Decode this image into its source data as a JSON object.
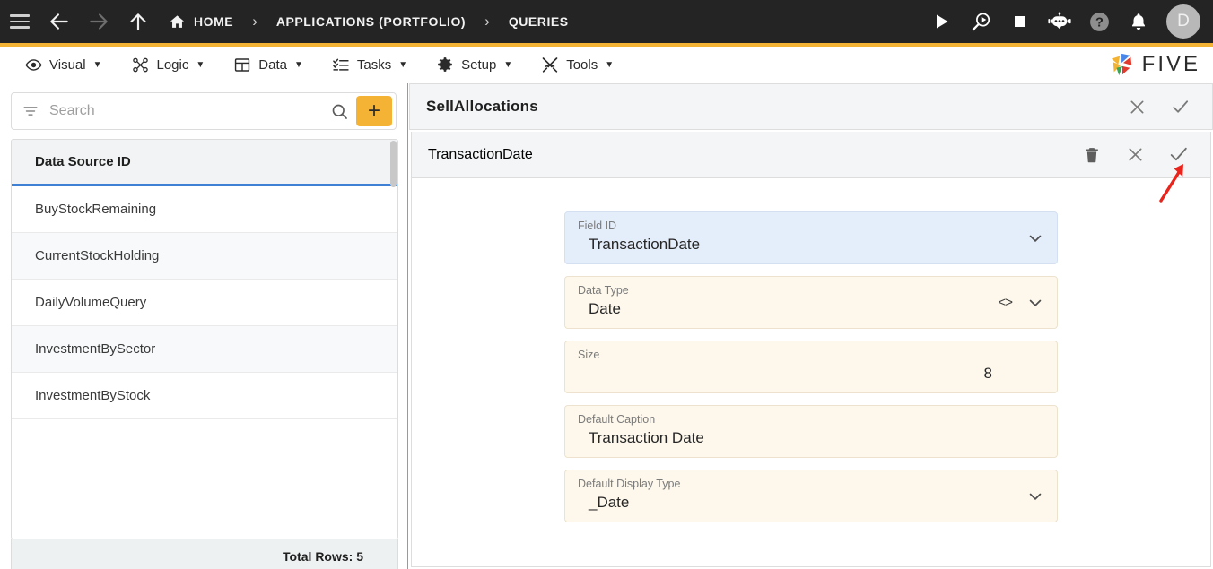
{
  "topnav": {
    "menu_icon": "hamburger-icon",
    "back_icon": "arrow-left-icon",
    "forward_icon": "arrow-right-icon",
    "up_icon": "arrow-up-icon",
    "home_icon": "home-icon",
    "breadcrumbs": [
      {
        "label": "HOME",
        "icon": "home-icon"
      },
      {
        "label": "APPLICATIONS (PORTFOLIO)",
        "icon": ""
      },
      {
        "label": "QUERIES",
        "icon": ""
      }
    ],
    "separator": "›",
    "tools": [
      {
        "name": "run-button",
        "icon": "play-icon"
      },
      {
        "name": "debug-button",
        "icon": "magnifier-play-icon"
      },
      {
        "name": "stop-button",
        "icon": "stop-square-icon"
      },
      {
        "name": "assistant-button",
        "icon": "robot-icon"
      },
      {
        "name": "help-button",
        "icon": "question-circle-icon"
      },
      {
        "name": "notifications-button",
        "icon": "bell-icon"
      }
    ],
    "avatar_initial": "D"
  },
  "menubar": {
    "items": [
      {
        "label": "Visual",
        "icon": "eye-icon",
        "caret": "▼"
      },
      {
        "label": "Logic",
        "icon": "flow-nodes-icon",
        "caret": "▼"
      },
      {
        "label": "Data",
        "icon": "table-grid-icon",
        "caret": "▼"
      },
      {
        "label": "Tasks",
        "icon": "checklist-icon",
        "caret": "▼"
      },
      {
        "label": "Setup",
        "icon": "gear-icon",
        "caret": "▼"
      },
      {
        "label": "Tools",
        "icon": "tools-cross-icon",
        "caret": "▼"
      }
    ],
    "brand": {
      "text": "FIVE",
      "mark": "five-pinwheel-logo"
    }
  },
  "left_panel": {
    "search": {
      "placeholder": "Search",
      "value": "",
      "filter_icon": "filter-icon",
      "search_icon": "search-icon"
    },
    "add_button": {
      "label": "+",
      "icon": "plus-icon"
    },
    "table": {
      "column_header": "Data Source ID",
      "rows": [
        {
          "name": "BuyStockRemaining"
        },
        {
          "name": "CurrentStockHolding"
        },
        {
          "name": "DailyVolumeQuery"
        },
        {
          "name": "InvestmentBySector"
        },
        {
          "name": "InvestmentByStock"
        }
      ]
    },
    "footer": {
      "total_rows_label": "Total Rows: 5"
    }
  },
  "right_panel": {
    "query_header": {
      "title": "SellAllocations",
      "actions": [
        {
          "name": "close-button",
          "icon": "close-icon"
        },
        {
          "name": "confirm-button",
          "icon": "check-icon"
        }
      ]
    },
    "field_header": {
      "title": "TransactionDate",
      "actions": [
        {
          "name": "delete-button",
          "icon": "trash-icon"
        },
        {
          "name": "close-button",
          "icon": "close-icon"
        },
        {
          "name": "confirm-button",
          "icon": "check-icon"
        }
      ]
    },
    "form": {
      "fields": [
        {
          "label": "Field ID",
          "value": "TransactionDate",
          "state": "focused",
          "has_chevron": true,
          "has_code_icon": false,
          "align": "left"
        },
        {
          "label": "Data Type",
          "value": "Date",
          "state": "normal",
          "has_chevron": true,
          "has_code_icon": true,
          "align": "left"
        },
        {
          "label": "Size",
          "value": "8",
          "state": "normal",
          "has_chevron": false,
          "has_code_icon": false,
          "align": "right"
        },
        {
          "label": "Default Caption",
          "value": "Transaction Date",
          "state": "normal",
          "has_chevron": false,
          "has_code_icon": false,
          "align": "left"
        },
        {
          "label": "Default Display Type",
          "value": "_Date",
          "state": "normal",
          "has_chevron": true,
          "has_code_icon": false,
          "align": "left"
        }
      ]
    }
  },
  "annotation": {
    "arrow": "red-arrow-pointing-to-confirm-button",
    "color": "#e8241c"
  },
  "colors": {
    "nav_background": "#242424",
    "accent_yellow": "#f5b335",
    "focused_field": "#e4edfa",
    "normal_field": "#fef8ec",
    "header_underline_blue": "#3f7fd4",
    "panel_header_gray": "#f4f5f6"
  }
}
